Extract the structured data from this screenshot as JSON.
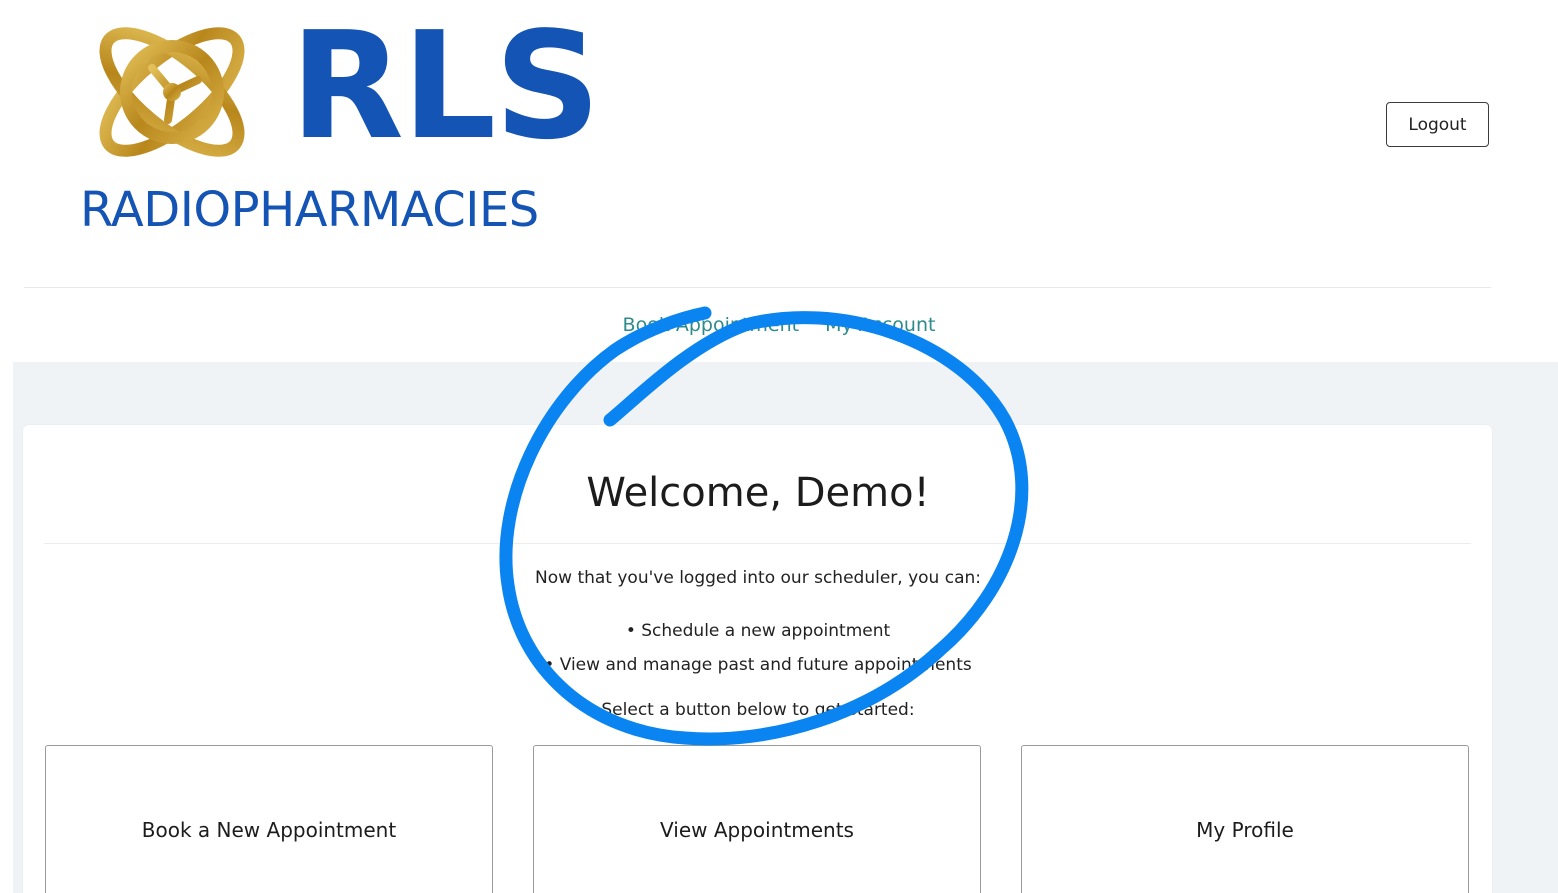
{
  "header": {
    "logo": {
      "wordmark": "RLS",
      "subtitle": "RADIOPHARMACIES",
      "mark_icon": "atom-orbit-logo-icon",
      "colors": {
        "wordmark": "#1454b4",
        "mark": "#c9a227"
      }
    },
    "logout_label": "Logout"
  },
  "nav": {
    "items": [
      {
        "label": "Book Appointment"
      },
      {
        "label": "My Account"
      }
    ],
    "color": "#2e8b8b"
  },
  "main": {
    "welcome_title": "Welcome, Demo!",
    "intro_text": "Now that you've logged into our scheduler, you can:",
    "bullets": [
      "• Schedule a new appointment",
      "• View and manage past and future appointments"
    ],
    "select_text": "Select a button below to get started:",
    "tiles": [
      {
        "label": "Book a New Appointment"
      },
      {
        "label": "View Appointments"
      },
      {
        "label": "My Profile"
      }
    ],
    "background_color": "#f0f3f6"
  },
  "annotation": {
    "shape": "hand-drawn-circle",
    "color": "#0a84f0"
  }
}
